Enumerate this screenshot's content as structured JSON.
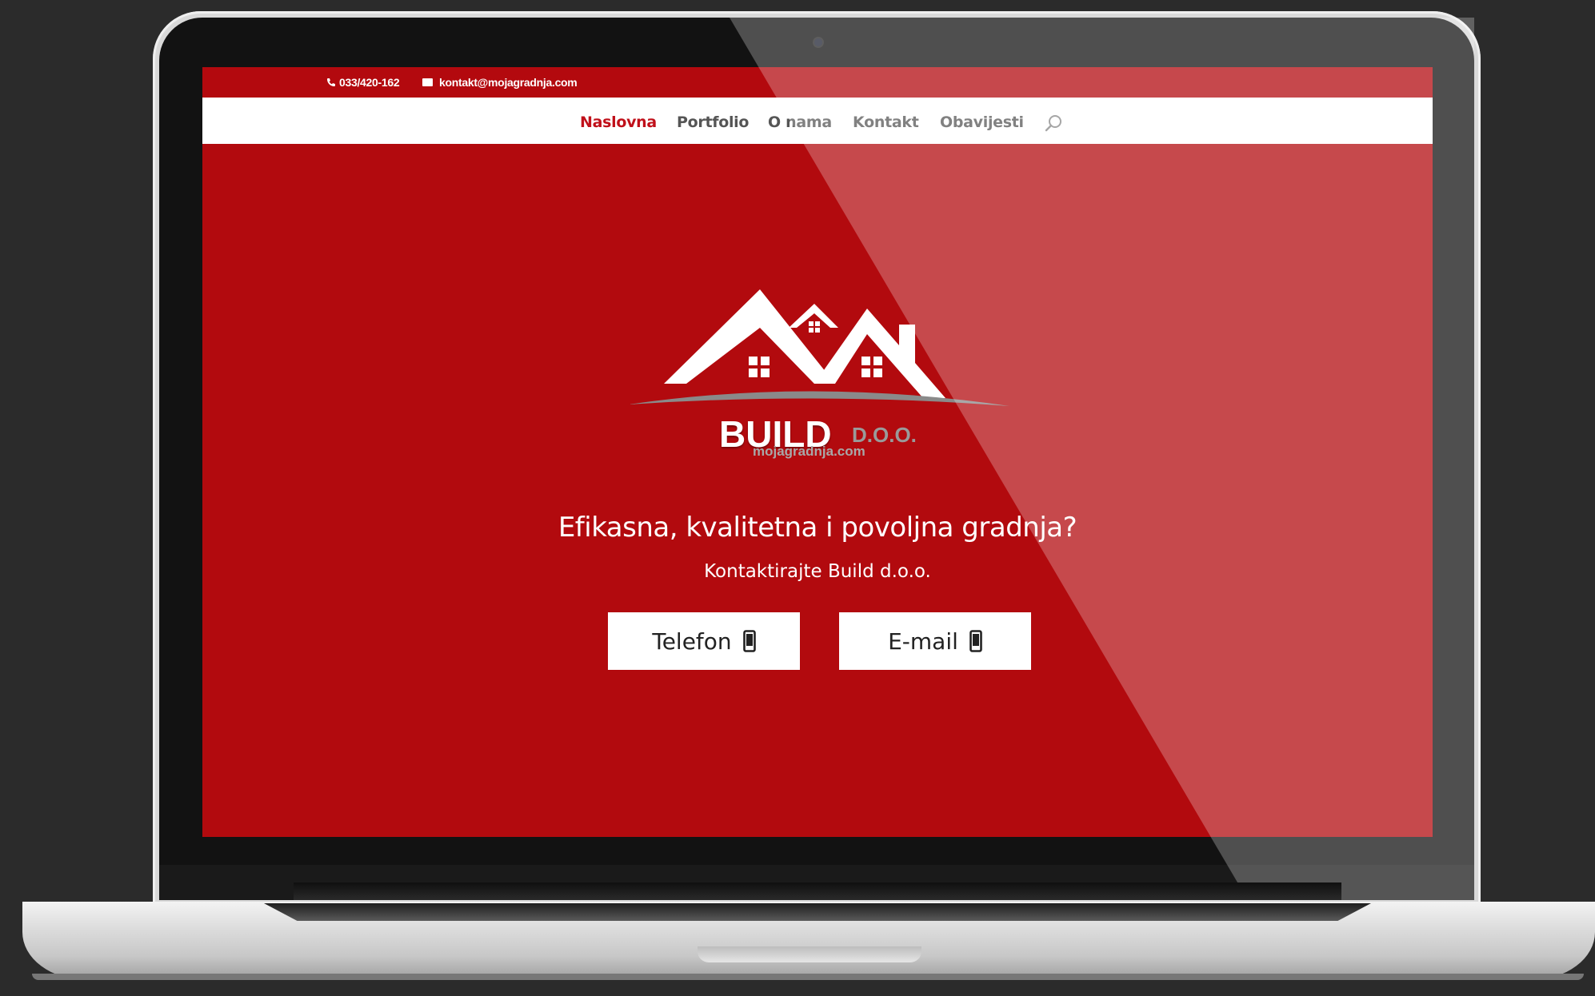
{
  "topbar": {
    "phone": "033/420-162",
    "email": "kontakt@mojagradnja.com"
  },
  "nav": {
    "items": [
      {
        "label": "Naslovna",
        "active": true
      },
      {
        "label": "Portfolio",
        "active": false
      },
      {
        "label": "O nama",
        "active": false
      },
      {
        "label": "Kontakt",
        "active": false
      },
      {
        "label": "Obavijesti",
        "active": false
      }
    ],
    "search_icon": "search-icon"
  },
  "logo": {
    "name": "BUILD",
    "suffix": "D.O.O.",
    "url": "mojagradnja.com"
  },
  "hero": {
    "headline": "Efikasna, kvalitetna i povoljna gradnja?",
    "subline": "Kontaktirajte Build d.o.o.",
    "buttons": [
      {
        "label": "Telefon",
        "icon": "mobile-phone-icon"
      },
      {
        "label": "E-mail",
        "icon": "mobile-phone-icon"
      }
    ]
  },
  "colors": {
    "brand_red": "#b20a0e",
    "active_nav": "#c0101a",
    "page_bg": "#2b2b2b"
  }
}
